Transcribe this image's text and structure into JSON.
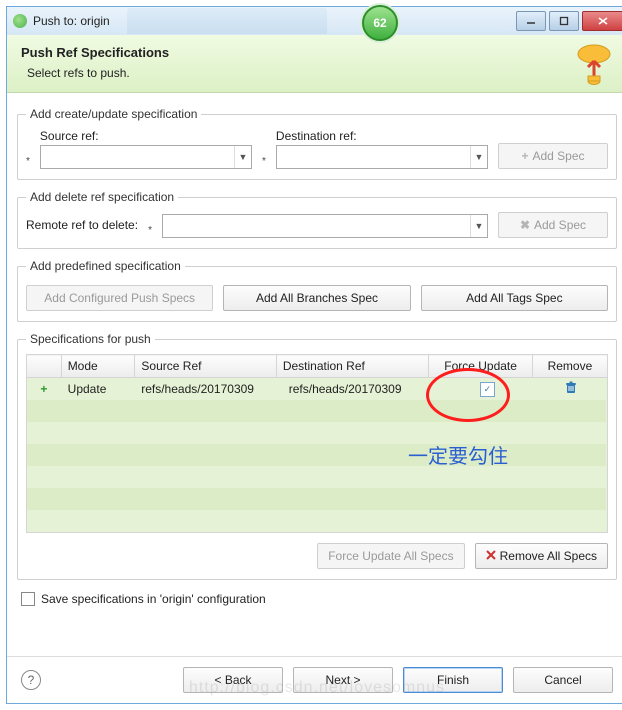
{
  "window": {
    "title": "Push to: origin",
    "badge": "62"
  },
  "header": {
    "title": "Push Ref Specifications",
    "subtitle": "Select refs to push."
  },
  "create_group": {
    "legend": "Add create/update specification",
    "source_label": "Source ref:",
    "dest_label": "Destination ref:",
    "add_btn": "Add Spec"
  },
  "delete_group": {
    "legend": "Add delete ref specification",
    "remote_label": "Remote ref to delete:",
    "add_btn": "Add Spec"
  },
  "predef_group": {
    "legend": "Add predefined specification",
    "configured_btn": "Add Configured Push Specs",
    "branches_btn": "Add All Branches Spec",
    "tags_btn": "Add All Tags Spec"
  },
  "specs_group": {
    "legend": "Specifications for push",
    "columns": {
      "mode": "Mode",
      "source": "Source Ref",
      "dest": "Destination Ref",
      "force": "Force Update",
      "remove": "Remove"
    },
    "rows": [
      {
        "mode": "Update",
        "source": "refs/heads/20170309",
        "dest": "refs/heads/20170309",
        "force_checked": true
      }
    ],
    "force_all_btn": "Force Update All Specs",
    "remove_all_btn": "Remove All Specs"
  },
  "save_label": "Save specifications in 'origin' configuration",
  "footer": {
    "back": "< Back",
    "next": "Next >",
    "finish": "Finish",
    "cancel": "Cancel"
  },
  "annotation": {
    "text": "一定要勾住"
  },
  "watermark": "http://blog.csdn.net/lovesomnus",
  "icons": {
    "plus": "+",
    "x": "✖",
    "check": "✓",
    "help": "?"
  }
}
